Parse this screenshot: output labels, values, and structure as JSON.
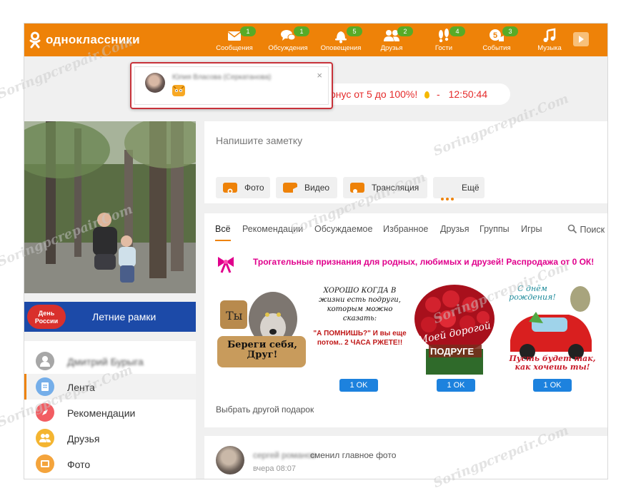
{
  "app": {
    "logo_text": "одноклассники"
  },
  "nav": [
    {
      "label": "Сообщения",
      "badge": "1",
      "icon": "envelope-icon"
    },
    {
      "label": "Обсуждения",
      "badge": "1",
      "icon": "chat-icon"
    },
    {
      "label": "Оповещения",
      "badge": "5",
      "icon": "bell-icon"
    },
    {
      "label": "Друзья",
      "badge": "2",
      "icon": "friends-icon"
    },
    {
      "label": "Гости",
      "badge": "4",
      "icon": "footprints-icon"
    },
    {
      "label": "События",
      "badge": "3",
      "icon": "events-icon",
      "inner": "5"
    },
    {
      "label": "Музыка",
      "badge": "",
      "icon": "music-note-icon"
    }
  ],
  "popup": {
    "name": "Юлия Власова (Серкатанова)",
    "close": "×"
  },
  "bonus": {
    "text": "бонус от 5 до 100%!",
    "dash": "-",
    "timer": "12:50:44"
  },
  "profile": {
    "frames_badge_line1": "День",
    "frames_badge_line2": "России",
    "frames_label": "Летние рамки"
  },
  "menu": [
    {
      "label": "Дмитрий Бурыга",
      "blurred": true,
      "icon": "user-icon",
      "color": "#a7a7a7"
    },
    {
      "label": "Лента",
      "active": true,
      "icon": "feed-icon",
      "color": "#75aee9"
    },
    {
      "label": "Рекомендации",
      "icon": "compass-icon",
      "color": "#f25d62"
    },
    {
      "label": "Друзья",
      "icon": "friends-icon",
      "color": "#f4b531"
    },
    {
      "label": "Фото",
      "icon": "photo-icon",
      "color": "#f4a43c"
    }
  ],
  "note": {
    "placeholder": "Напишите заметку",
    "buttons": [
      {
        "label": "Фото",
        "icon": "camera-icon"
      },
      {
        "label": "Видео",
        "icon": "video-icon"
      },
      {
        "label": "Трансляция",
        "icon": "broadcast-icon"
      },
      {
        "label": "Ещё",
        "icon": "more-dots-icon"
      }
    ]
  },
  "feed": {
    "tabs": [
      "Всё",
      "Рекомендации",
      "Обсуждаемое",
      "Избранное",
      "Друзья",
      "Группы",
      "Игры"
    ],
    "search": "Поиск",
    "gift_promo": "Трогательные признания для родных, любимых и друзей! Распродажа от 0 ОК!",
    "gifts": [
      {
        "caption_a": "Ты",
        "caption_b": "Береги себя, Друг!",
        "price": "1 OK"
      },
      {
        "caption_a": "ХОРОШО КОГДА В жизни есть подруги, которым можно сказать:",
        "caption_b": "\"А ПОМНИШЬ?\" И вы еще потом.. 2 ЧАСА РЖЕТЕ!!",
        "price": ""
      },
      {
        "caption_a": "Моей дорогой",
        "caption_b": "ПОДРУГЕ",
        "price": "1 OK"
      },
      {
        "caption_a": "С днём рождения!",
        "caption_b": "Пусть будет так, как хочешь ты!",
        "price": "1 OK"
      }
    ],
    "other_gift": "Выбрать другой подарок"
  },
  "story": {
    "name": "сергей романов",
    "action": "сменил главное фото",
    "time": "вчера 08:07"
  },
  "watermark": "Soringpcrepair.Com",
  "colors": {
    "brand": "#ee8208",
    "badge": "#57ab27",
    "ok_button": "#1d82de",
    "promo": "#e0008c",
    "bonus": "#e52b2b"
  }
}
